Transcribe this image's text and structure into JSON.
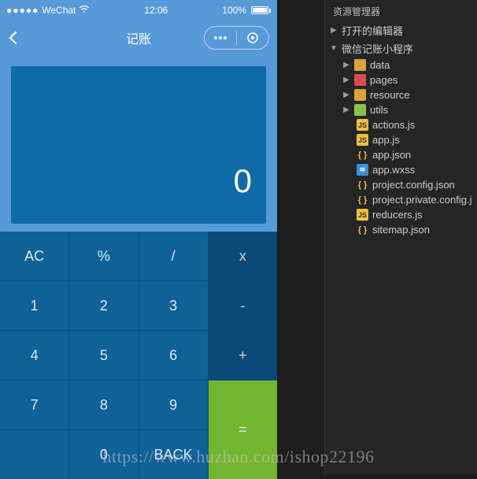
{
  "status": {
    "signal": "●●●●●",
    "carrier": "WeChat",
    "wifi": "≈",
    "time": "12:06",
    "battery_pct": "100%"
  },
  "nav": {
    "title": "记账"
  },
  "calc": {
    "display": "0",
    "keys": {
      "ac": "AC",
      "pct": "%",
      "div": "/",
      "mul": "x",
      "n1": "1",
      "n2": "2",
      "n3": "3",
      "minus": "-",
      "n4": "4",
      "n5": "5",
      "n6": "6",
      "plus": "+",
      "n7": "7",
      "n8": "8",
      "n9": "9",
      "eq": "=",
      "n0": "0",
      "back": "BACK"
    }
  },
  "explorer": {
    "header": "资源管理器",
    "open_editors": "打开的编辑器",
    "project": "微信记账小程序",
    "folders": {
      "data": "data",
      "pages": "pages",
      "resource": "resource",
      "utils": "utils"
    },
    "files": {
      "actions": "actions.js",
      "app_js": "app.js",
      "app_json": "app.json",
      "app_wxss": "app.wxss",
      "project_config": "project.config.json",
      "project_private": "project.private.config.j",
      "reducers": "reducers.js",
      "sitemap": "sitemap.json"
    }
  },
  "watermark": "https://www.huzhan.com/ishop22196"
}
